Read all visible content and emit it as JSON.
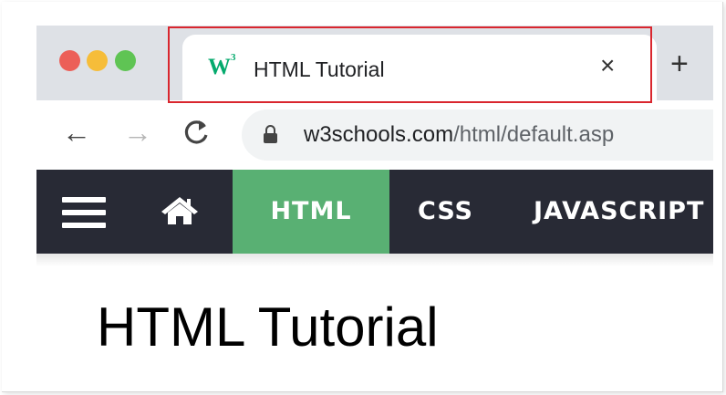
{
  "tab": {
    "favicon": "W",
    "favicon_sup": "3",
    "title": "HTML Tutorial",
    "close_glyph": "×"
  },
  "new_tab_glyph": "+",
  "toolbar": {
    "back_glyph": "←",
    "forward_glyph": "→",
    "reload_glyph": "C"
  },
  "address": {
    "host": "w3schools.com",
    "path": "/html/default.asp"
  },
  "site_nav": {
    "items": [
      {
        "label": "HTML",
        "active": true
      },
      {
        "label": "CSS",
        "active": false
      },
      {
        "label": "JAVASCRIPT",
        "active": false
      }
    ]
  },
  "page": {
    "title": "HTML Tutorial"
  },
  "colors": {
    "accent": "#59b073",
    "nav_bg": "#282a35",
    "highlight": "#d9262e"
  }
}
